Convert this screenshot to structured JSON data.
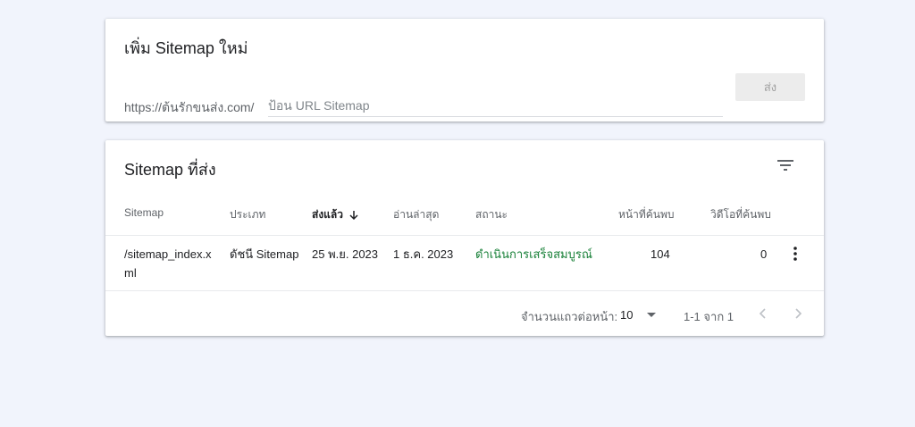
{
  "add_card": {
    "title": "เพิ่ม Sitemap ใหม่",
    "url_prefix": "https://ต้นรักขนส่ง.com/",
    "url_placeholder": "ป้อน URL Sitemap",
    "submit_label": "ส่ง"
  },
  "list_card": {
    "title": "Sitemap ที่ส่ง",
    "filter_icon": "filter-icon",
    "columns": {
      "sitemap": "Sitemap",
      "type": "ประเภท",
      "submitted": "ส่งแล้ว",
      "last_read": "อ่านล่าสุด",
      "status": "สถานะ",
      "pages_found": "หน้าที่ค้นพบ",
      "videos_found": "วิดีโอที่ค้นพบ"
    },
    "sort_icon": "arrow-down-icon",
    "rows": [
      {
        "sitemap": "/sitemap_index.xml",
        "type": "ดัชนี Sitemap",
        "submitted": "25 พ.ย. 2023",
        "last_read": "1 ธ.ค. 2023",
        "status": "ดำเนินการเสร็จสมบูรณ์",
        "pages_found": "104",
        "videos_found": "0"
      }
    ],
    "footer": {
      "rows_per_page_label": "จำนวนแถวต่อหน้า:",
      "rows_per_page_value": "10",
      "range_label": "1-1 จาก 1"
    }
  },
  "colors": {
    "background": "#f1f4fc",
    "status_success": "#188038",
    "button_disabled_bg": "#ececec",
    "muted_text": "#5f6368"
  }
}
